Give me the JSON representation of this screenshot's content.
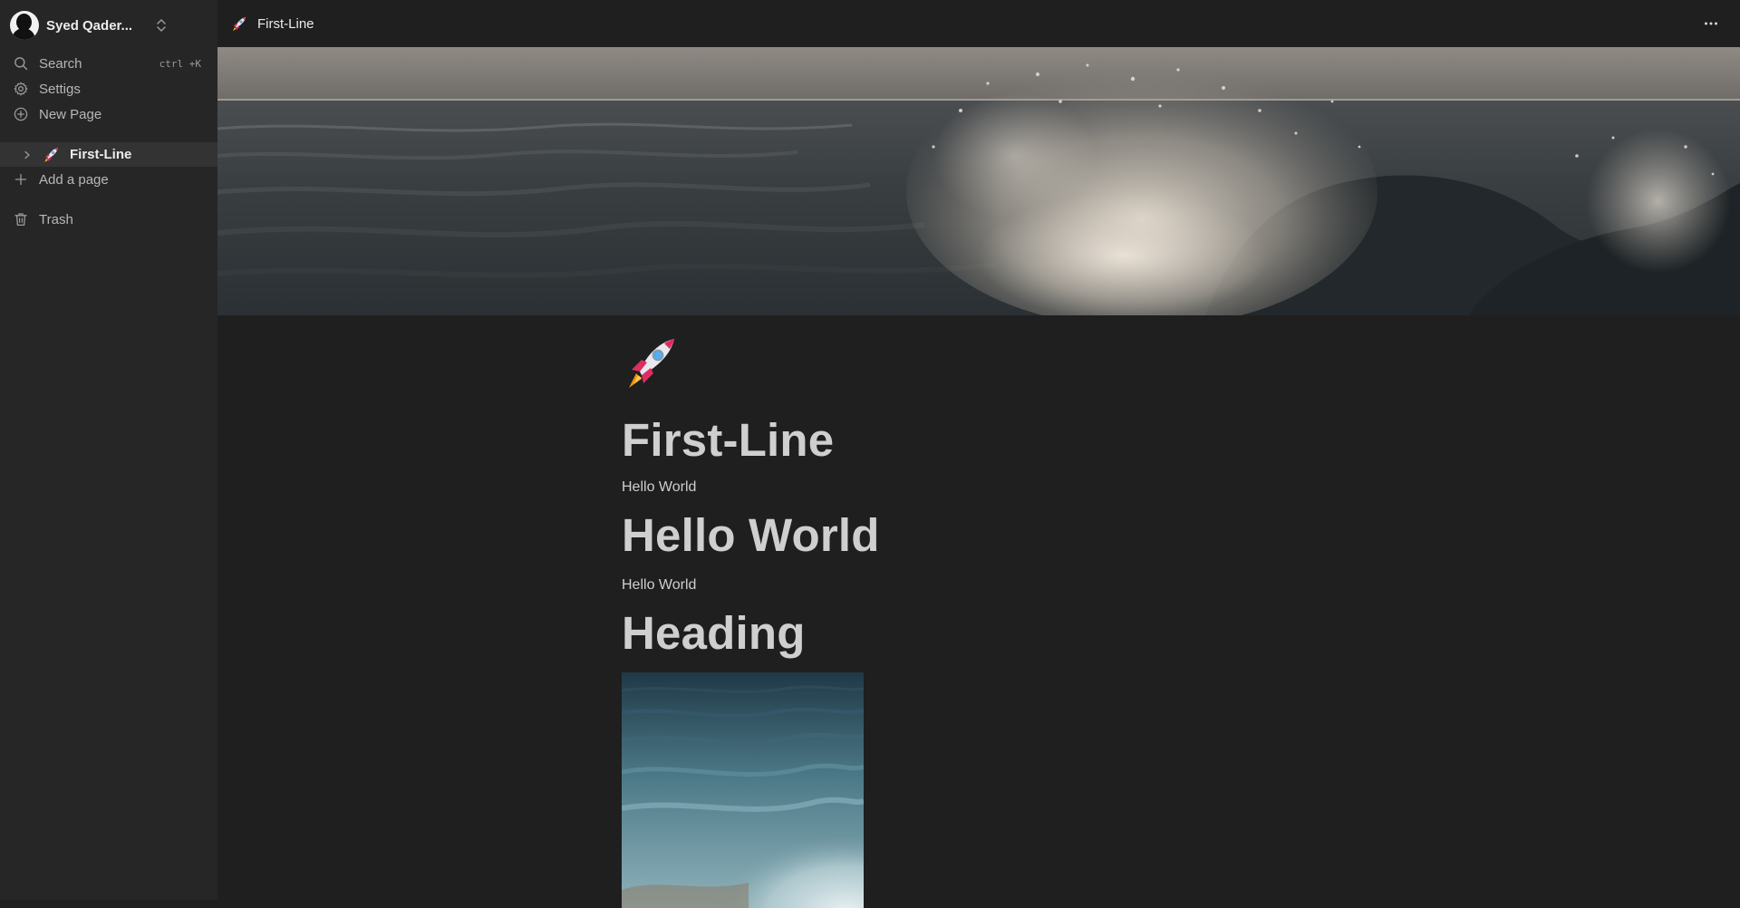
{
  "sidebar": {
    "workspace_name": "Syed Qader...",
    "nav": {
      "search_label": "Search",
      "search_shortcut": "ctrl +K",
      "settings_label": "Settigs",
      "new_page_label": "New Page"
    },
    "pages": [
      {
        "icon": "rocket-emoji",
        "title": "First-Line",
        "selected": true
      }
    ],
    "add_page_label": "Add a page",
    "trash_label": "Trash"
  },
  "topbar": {
    "breadcrumb_title": "First-Line",
    "more_icon": "ellipsis-icon"
  },
  "document": {
    "icon": "rocket-emoji",
    "title": "First-Line",
    "blocks": [
      {
        "type": "paragraph",
        "text": "Hello World"
      },
      {
        "type": "heading",
        "text": "Hello World"
      },
      {
        "type": "paragraph",
        "text": "Hello World"
      },
      {
        "type": "heading",
        "text": "Heading"
      },
      {
        "type": "image",
        "subject": "ocean-wave-photo"
      }
    ]
  },
  "cover": {
    "subject": "ocean-wave-splash-photo"
  },
  "colors": {
    "background": "#1f1f1f",
    "sidebar": "#262626",
    "sidebar_selected": "#333333",
    "text": "#cfcfcf",
    "muted_text": "#b7b7b7"
  }
}
